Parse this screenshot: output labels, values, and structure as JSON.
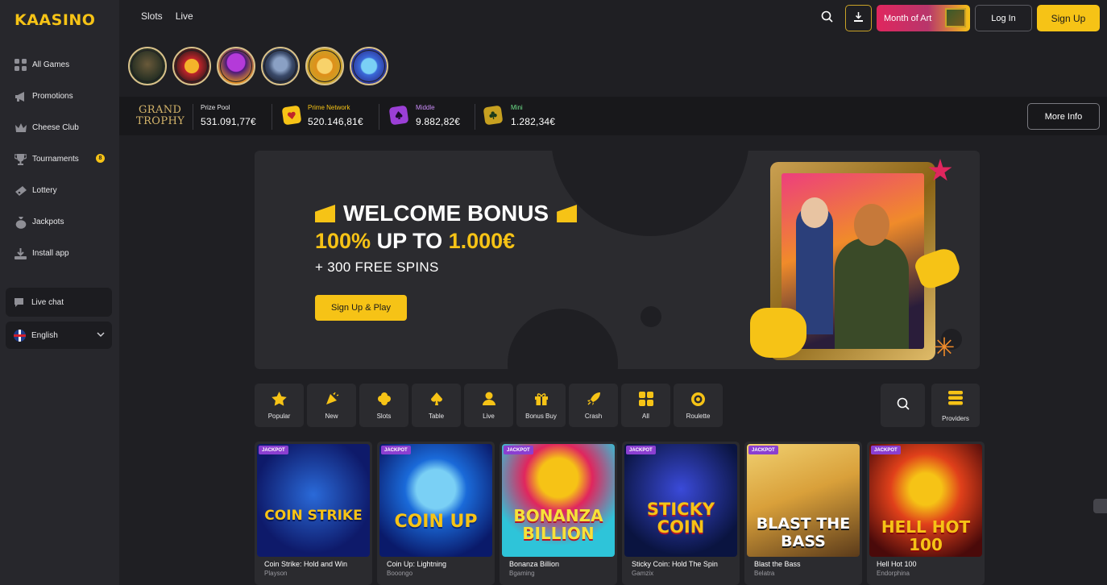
{
  "brand": {
    "logo_text": "KAASINO"
  },
  "sidebar": {
    "items": [
      {
        "label": "All Games",
        "icon": "grid-icon"
      },
      {
        "label": "Promotions",
        "icon": "megaphone-icon"
      },
      {
        "label": "Cheese Club",
        "icon": "crown-icon"
      },
      {
        "label": "Tournaments",
        "icon": "trophy-icon",
        "badge": "8"
      },
      {
        "label": "Lottery",
        "icon": "ticket-icon"
      },
      {
        "label": "Jackpots",
        "icon": "money-bag-icon"
      },
      {
        "label": "Install app",
        "icon": "download-icon"
      }
    ],
    "live_chat": "Live chat",
    "language": "English"
  },
  "header": {
    "tabs": [
      "Slots",
      "Live"
    ],
    "month_of_art": "Month of Art",
    "login": "Log In",
    "signup": "Sign Up"
  },
  "jackpot": {
    "grand_trophy_line1": "GRAND",
    "grand_trophy_line2": "TROPHY",
    "prize_pool_label": "Prize Pool",
    "prize_pool_value": "531.091,77€",
    "prime_label": "Prime Network",
    "prime_value": "520.146,81€",
    "middle_label": "Middle",
    "middle_value": "9.882,82€",
    "mini_label": "Mini",
    "mini_value": "1.282,34€",
    "more_info": "More Info",
    "colors": {
      "prime": "#f6c316",
      "middle": "#c88bf5",
      "mini": "#6ee08a"
    }
  },
  "banner": {
    "title": "WELCOME BONUS",
    "line2_a": "100%",
    "line2_b": " UP TO ",
    "line2_c": "1.000€",
    "line3": "+ 300 FREE SPINS",
    "cta": "Sign Up & Play"
  },
  "categories": [
    {
      "label": "Popular",
      "icon": "star-icon"
    },
    {
      "label": "New",
      "icon": "party-popper-icon"
    },
    {
      "label": "Slots",
      "icon": "clover-icon"
    },
    {
      "label": "Table",
      "icon": "spade-icon"
    },
    {
      "label": "Live",
      "icon": "dealer-icon"
    },
    {
      "label": "Bonus Buy",
      "icon": "gift-icon"
    },
    {
      "label": "Crash",
      "icon": "rocket-icon"
    },
    {
      "label": "All",
      "icon": "grid-icon"
    },
    {
      "label": "Roulette",
      "icon": "roulette-icon"
    }
  ],
  "providers_label": "Providers",
  "games": [
    {
      "name": "Coin Strike: Hold and Win",
      "provider": "Playson",
      "badge": "JACKPOT",
      "art_title": "COIN STRIKE"
    },
    {
      "name": "Coin Up: Lightning",
      "provider": "Booongo",
      "badge": "JACKPOT",
      "art_title": "COIN UP"
    },
    {
      "name": "Bonanza Billion",
      "provider": "Bgaming",
      "badge": "JACKPOT",
      "art_title": "BONANZA BILLION"
    },
    {
      "name": "Sticky Coin: Hold The Spin",
      "provider": "Gamzix",
      "badge": "JACKPOT",
      "art_title": "STICKY COIN"
    },
    {
      "name": "Blast the Bass",
      "provider": "Belatra",
      "badge": "JACKPOT",
      "art_title": "BLAST THE BASS"
    },
    {
      "name": "Hell Hot 100",
      "provider": "Endorphina",
      "badge": "JACKPOT",
      "art_title": "HELL HOT 100"
    }
  ]
}
